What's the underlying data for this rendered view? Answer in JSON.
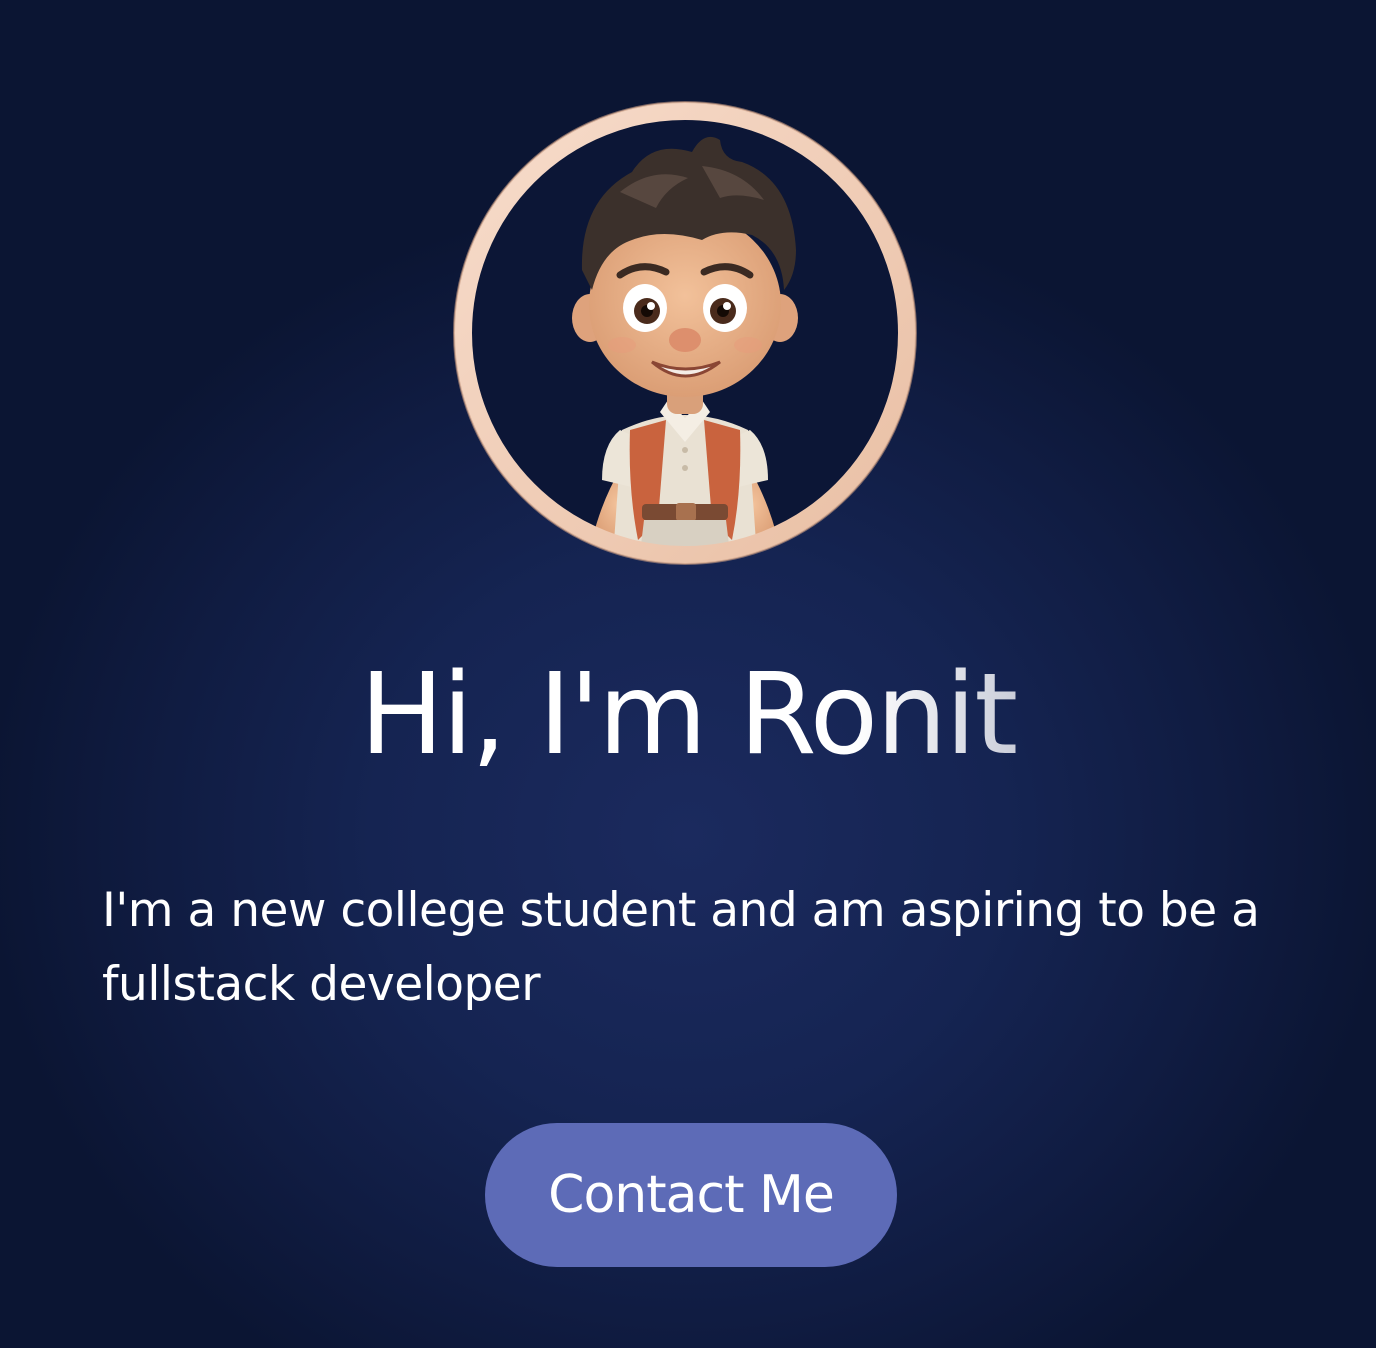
{
  "profile": {
    "avatar_alt": "cartoon avatar",
    "greeting": "Hi, I'm Ronit",
    "bio": "I'm a new college student and am aspiring to be a fullstack developer"
  },
  "actions": {
    "contact_label": "Contact Me"
  },
  "colors": {
    "background": "#101c42",
    "ring": "#f2d3bd",
    "button": "#5d6bb7",
    "text": "#ffffff"
  }
}
